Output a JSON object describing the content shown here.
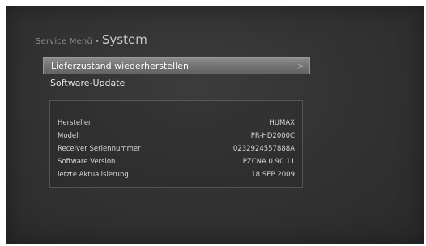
{
  "breadcrumb": {
    "parent": "Service Menü",
    "separator": "•",
    "current": "System"
  },
  "menu": {
    "items": [
      {
        "label": "Lieferzustand wiederherstellen",
        "selected": true,
        "arrow": ">"
      },
      {
        "label": "Software-Update",
        "selected": false
      }
    ]
  },
  "info": {
    "rows": [
      {
        "key": "Hersteller",
        "value": "HUMAX"
      },
      {
        "key": "Modell",
        "value": "PR-HD2000C"
      },
      {
        "key": "Receiver Seriennummer",
        "value": "0232924557888A"
      },
      {
        "key": "Software Version",
        "value": "PZCNA 0.90.11"
      },
      {
        "key": "letzte Aktualisierung",
        "value": "18 SEP 2009"
      }
    ]
  },
  "colors": {
    "background": "#333333",
    "highlight": "#7a7a7a",
    "text": "#e8e8e8"
  }
}
